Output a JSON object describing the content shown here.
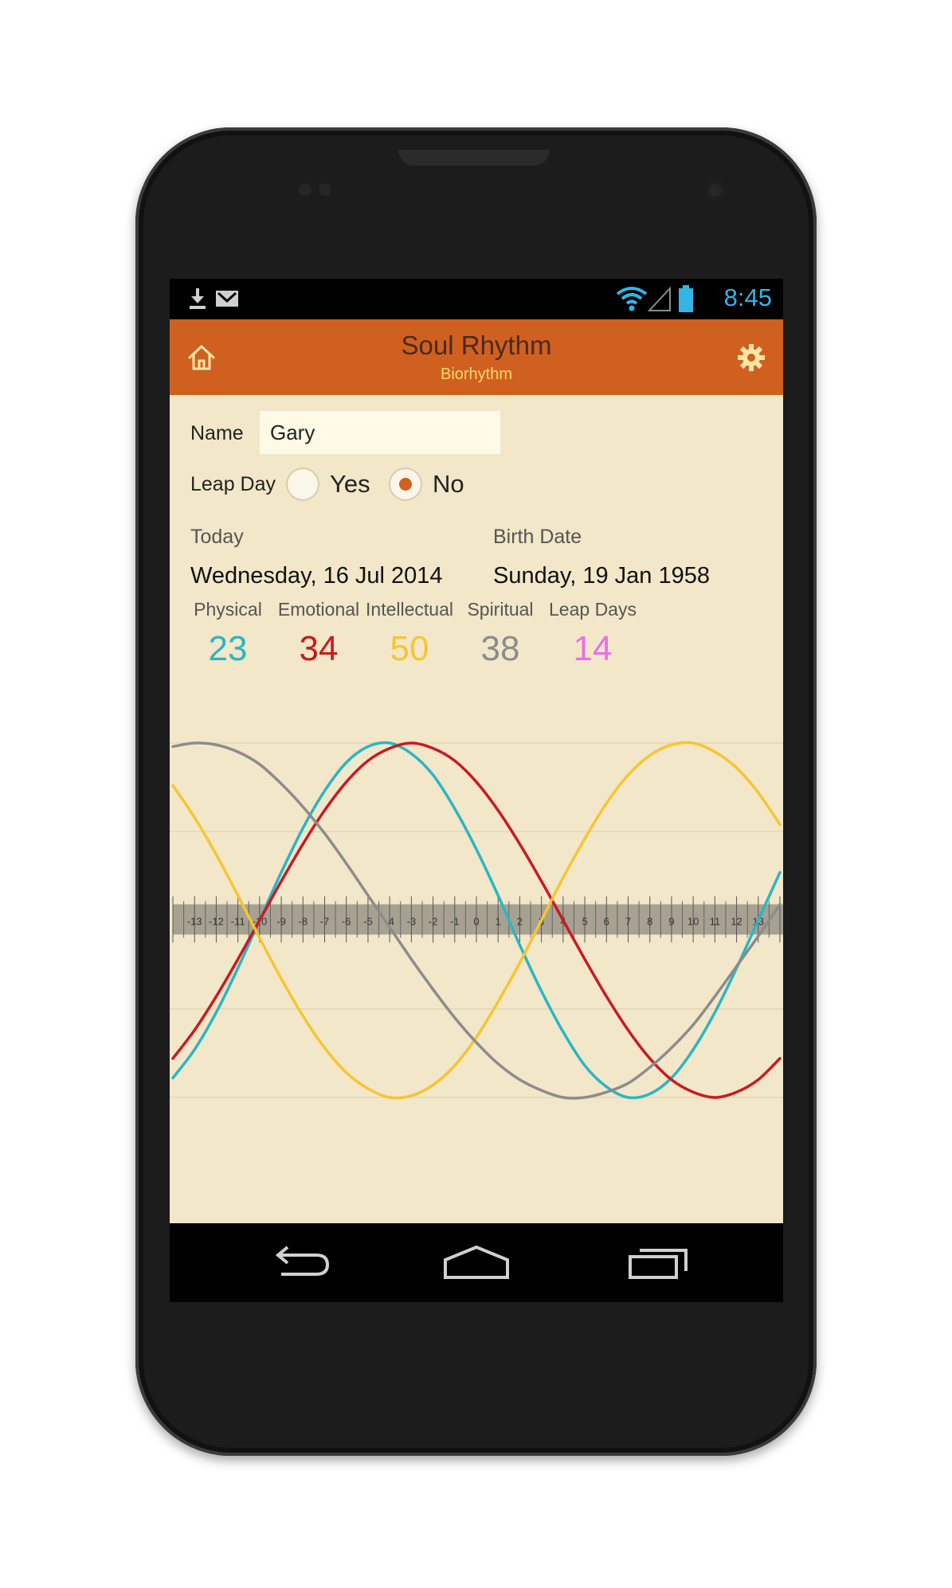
{
  "status_bar": {
    "time": "8:45"
  },
  "app_bar": {
    "title": "Soul Rhythm",
    "subtitle": "Biorhythm"
  },
  "form": {
    "name_label": "Name",
    "name_value": "Gary",
    "leap_day_label": "Leap Day",
    "leap_yes": "Yes",
    "leap_no": "No",
    "leap_selected": "No"
  },
  "dates": {
    "today_label": "Today",
    "today_value": "Wednesday, 16 Jul 2014",
    "birth_label": "Birth Date",
    "birth_value": "Sunday, 19 Jan 1958"
  },
  "cycles": [
    {
      "name": "Physical",
      "value": "23",
      "color": "#2bb5c6"
    },
    {
      "name": "Emotional",
      "value": "34",
      "color": "#c91a22"
    },
    {
      "name": "Intellectual",
      "value": "50",
      "color": "#f6c531"
    },
    {
      "name": "Spiritual",
      "value": "38",
      "color": "#8c8c8c"
    },
    {
      "name": "Leap Days",
      "value": "14",
      "color": "#e96fe8"
    }
  ],
  "chart_data": {
    "type": "line",
    "x": [
      -14,
      -13,
      -12,
      -11,
      -10,
      -9,
      -8,
      -7,
      -6,
      -5,
      -4,
      -3,
      -2,
      -1,
      0,
      1,
      2,
      3,
      4,
      5,
      6,
      7,
      8,
      9,
      10,
      11,
      12,
      13,
      14
    ],
    "tick_labels": [
      "-13",
      "-12",
      "-11",
      "-10",
      "-9",
      "-8",
      "-7",
      "-6",
      "-5",
      "-4",
      "-3",
      "-2",
      "-1",
      "0",
      "1",
      "2",
      "3",
      "4",
      "5",
      "6",
      "7",
      "8",
      "9",
      "10",
      "11",
      "12",
      "13"
    ],
    "ylim": [
      -1,
      1
    ],
    "grid": true,
    "series": [
      {
        "name": "Physical",
        "color": "#2bb5c6",
        "values": [
          -0.89,
          -0.73,
          -0.52,
          -0.27,
          0.0,
          0.27,
          0.52,
          0.73,
          0.89,
          0.98,
          1.0,
          0.94,
          0.82,
          0.63,
          0.4,
          0.14,
          -0.14,
          -0.4,
          -0.63,
          -0.82,
          -0.94,
          -1.0,
          -0.98,
          -0.89,
          -0.73,
          -0.52,
          -0.27,
          0.0,
          0.27
        ]
      },
      {
        "name": "Emotional",
        "color": "#c91a22",
        "values": [
          -0.78,
          -0.62,
          -0.43,
          -0.22,
          0.0,
          0.22,
          0.43,
          0.62,
          0.78,
          0.9,
          0.97,
          1.0,
          0.97,
          0.9,
          0.78,
          0.62,
          0.43,
          0.22,
          0.0,
          -0.22,
          -0.43,
          -0.62,
          -0.78,
          -0.9,
          -0.97,
          -1.0,
          -0.97,
          -0.9,
          -0.78
        ]
      },
      {
        "name": "Intellectual",
        "color": "#f6c531",
        "values": [
          0.76,
          0.58,
          0.37,
          0.14,
          -0.1,
          -0.33,
          -0.54,
          -0.72,
          -0.86,
          -0.95,
          -1.0,
          -0.99,
          -0.93,
          -0.82,
          -0.66,
          -0.46,
          -0.24,
          -0.0,
          0.24,
          0.46,
          0.66,
          0.82,
          0.93,
          0.99,
          1.0,
          0.95,
          0.86,
          0.72,
          0.54
        ]
      },
      {
        "name": "Spiritual",
        "color": "#8c8c8c",
        "values": [
          0.98,
          1.0,
          0.99,
          0.95,
          0.88,
          0.77,
          0.64,
          0.49,
          0.32,
          0.14,
          -0.04,
          -0.22,
          -0.39,
          -0.55,
          -0.69,
          -0.81,
          -0.9,
          -0.96,
          -1.0,
          -1.0,
          -0.97,
          -0.92,
          -0.83,
          -0.72,
          -0.59,
          -0.43,
          -0.26,
          -0.09,
          0.09
        ]
      }
    ]
  }
}
